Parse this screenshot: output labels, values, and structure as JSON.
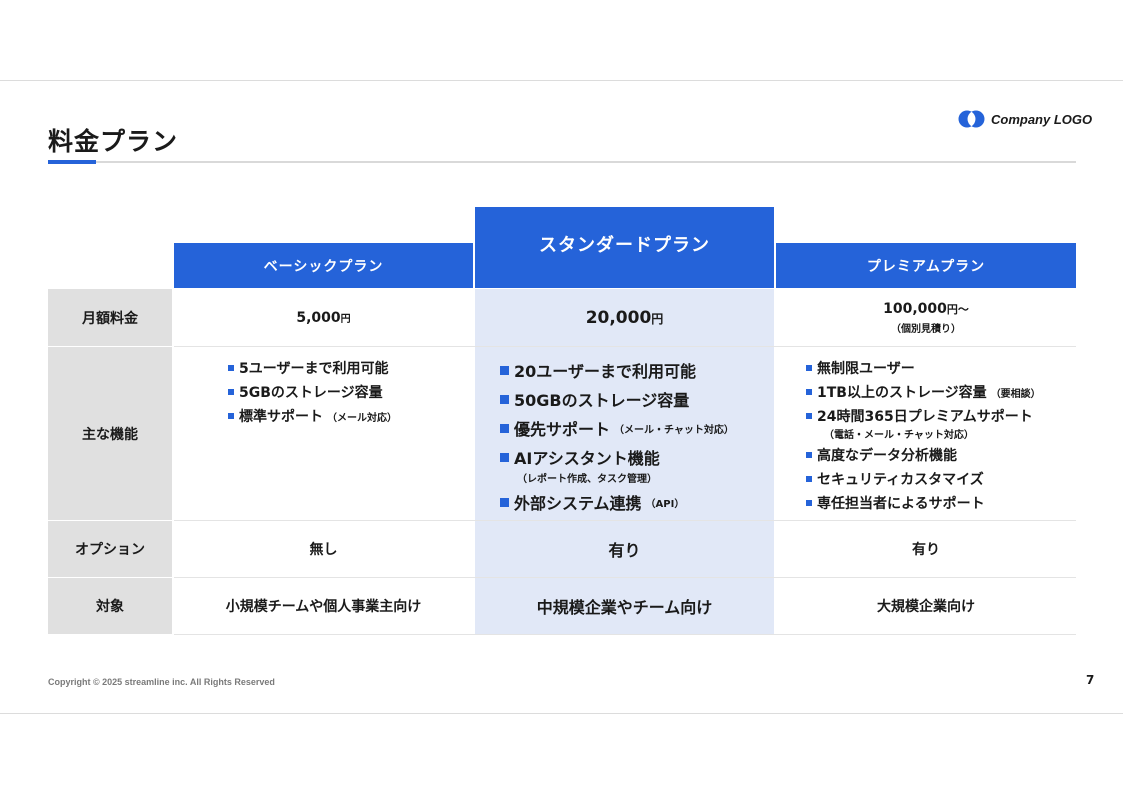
{
  "page": {
    "title": "料金プラン",
    "logo_text": "Company LOGO",
    "copyright": "Copyright © 2025 streamline inc. All Rights Reserved",
    "page_number": "7",
    "accent_color": "#2563d9",
    "highlight_color": "#e1e8f7"
  },
  "plans": [
    {
      "name": "ベーシックプラン",
      "price": "5,000",
      "price_unit": "円",
      "price_note": "",
      "features": [
        {
          "text": "5ユーザーまで利用可能",
          "small": "",
          "sub": ""
        },
        {
          "text": "5GBのストレージ容量",
          "small": "",
          "sub": ""
        },
        {
          "text": "標準サポート",
          "small": "（メール対応）",
          "sub": ""
        }
      ],
      "option": "無し",
      "target": "小規模チームや個人事業主向け"
    },
    {
      "name": "スタンダードプラン",
      "price": "20,000",
      "price_unit": "円",
      "price_note": "",
      "features": [
        {
          "text": "20ユーザーまで利用可能",
          "small": "",
          "sub": ""
        },
        {
          "text": "50GBのストレージ容量",
          "small": "",
          "sub": ""
        },
        {
          "text": "優先サポート",
          "small": "（メール・チャット対応）",
          "sub": ""
        },
        {
          "text": "AIアシスタント機能",
          "small": "",
          "sub": "（レポート作成、タスク管理）"
        },
        {
          "text": "外部システム連携",
          "small": "（API）",
          "sub": ""
        }
      ],
      "option": "有り",
      "target": "中規模企業やチーム向け"
    },
    {
      "name": "プレミアムプラン",
      "price": "100,000",
      "price_unit": "円〜",
      "price_note": "（個別見積り）",
      "features": [
        {
          "text": "無制限ユーザー",
          "small": "",
          "sub": ""
        },
        {
          "text": "1TB以上のストレージ容量",
          "small": "（要相談）",
          "sub": ""
        },
        {
          "text": "24時間365日プレミアムサポート",
          "small": "",
          "sub": "（電話・メール・チャット対応）"
        },
        {
          "text": "高度なデータ分析機能",
          "small": "",
          "sub": ""
        },
        {
          "text": "セキュリティカスタマイズ",
          "small": "",
          "sub": ""
        },
        {
          "text": "専任担当者によるサポート",
          "small": "",
          "sub": ""
        }
      ],
      "option": "有り",
      "target": "大規模企業向け"
    }
  ],
  "row_labels": {
    "price": "月額料金",
    "features": "主な機能",
    "option": "オプション",
    "target": "対象"
  }
}
